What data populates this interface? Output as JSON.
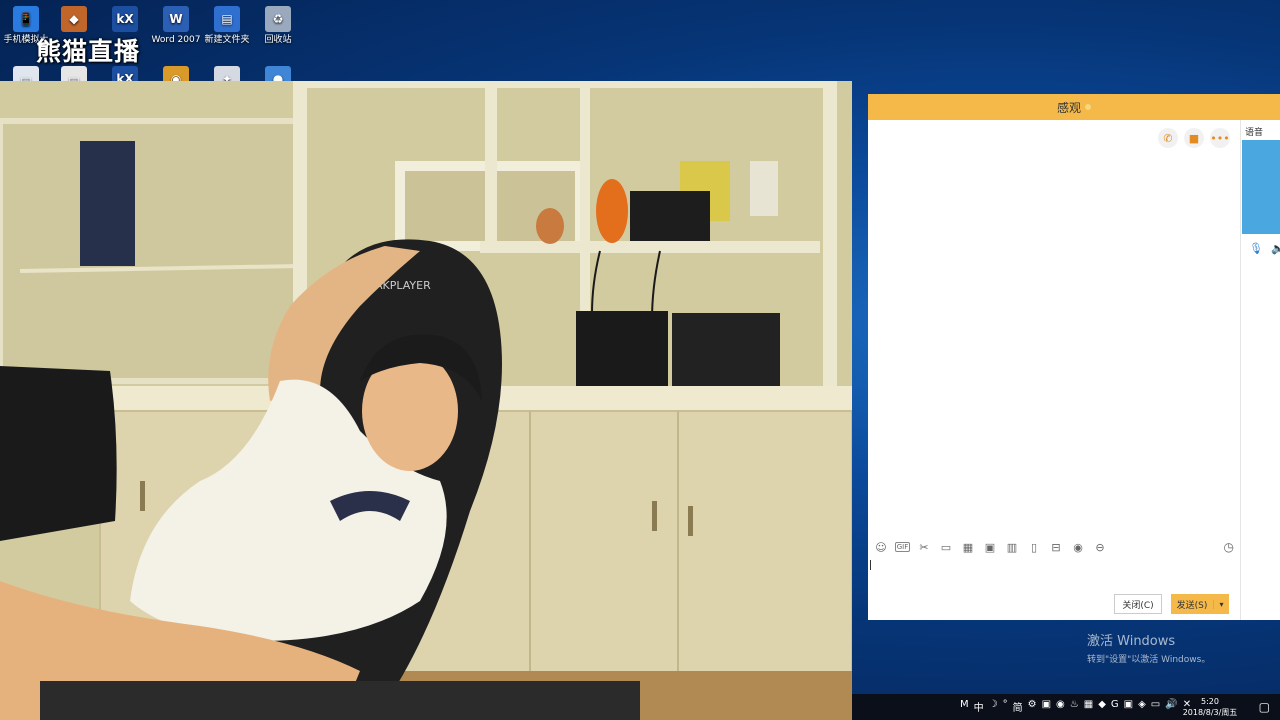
{
  "desktop": {
    "watermark": "熊猫直播",
    "icons_row1": [
      {
        "label": "手机模拟大",
        "icon": "phone-emulator-icon",
        "color": "#2a7be0",
        "glyph": "📱"
      },
      {
        "label": "",
        "icon": "game-icon",
        "color": "#c0662a",
        "glyph": "◆"
      },
      {
        "label": "",
        "icon": "kx-app-icon",
        "color": "#1c4fa0",
        "glyph": "kX"
      },
      {
        "label": "Word 2007",
        "icon": "word-icon",
        "color": "#2b5fb4",
        "glyph": "W"
      },
      {
        "label": "新建文件夹",
        "icon": "folder-icon",
        "color": "#2f6fcf",
        "glyph": "▤"
      },
      {
        "label": "回收站",
        "icon": "recycle-bin-icon",
        "color": "#9aa9bd",
        "glyph": "♻"
      }
    ],
    "icons_row2": [
      {
        "icon": "document-icon",
        "color": "#dfe6ef",
        "glyph": "▭"
      },
      {
        "icon": "window-icon",
        "color": "#e6e6e6",
        "glyph": "▭"
      },
      {
        "icon": "kx-app-icon-2",
        "color": "#1c4fa0",
        "glyph": "kX"
      },
      {
        "icon": "tiger-icon",
        "color": "#d99a2a",
        "glyph": "◉"
      },
      {
        "icon": "gamepad-icon",
        "color": "#d5d9e2",
        "glyph": "✦"
      },
      {
        "icon": "globe-icon",
        "color": "#3f86d6",
        "glyph": "●"
      }
    ]
  },
  "chat": {
    "title": "感观",
    "tools": [
      "phone-icon",
      "video-icon",
      "more-icon"
    ],
    "toolbar_icons": [
      "emoji-icon",
      "gif-icon",
      "scissors-icon",
      "folder-icon",
      "apps-icon",
      "image-icon",
      "screenshot-icon",
      "phone-small-icon",
      "delete-icon",
      "music-icon",
      "minus-icon"
    ],
    "close_label": "关闭(C)",
    "send_label": "发送(S)",
    "side_title": "语音"
  },
  "activate": {
    "line1": "激活 Windows",
    "line2": "转到\"设置\"以激活 Windows。"
  },
  "taskbar": {
    "tray": [
      "M",
      "中",
      "☽",
      "°,",
      "简",
      "⚙",
      "",
      "",
      "",
      "",
      "",
      "",
      "",
      "",
      "",
      "",
      ""
    ],
    "time": "5:20",
    "date": "2018/8/3/周五"
  }
}
